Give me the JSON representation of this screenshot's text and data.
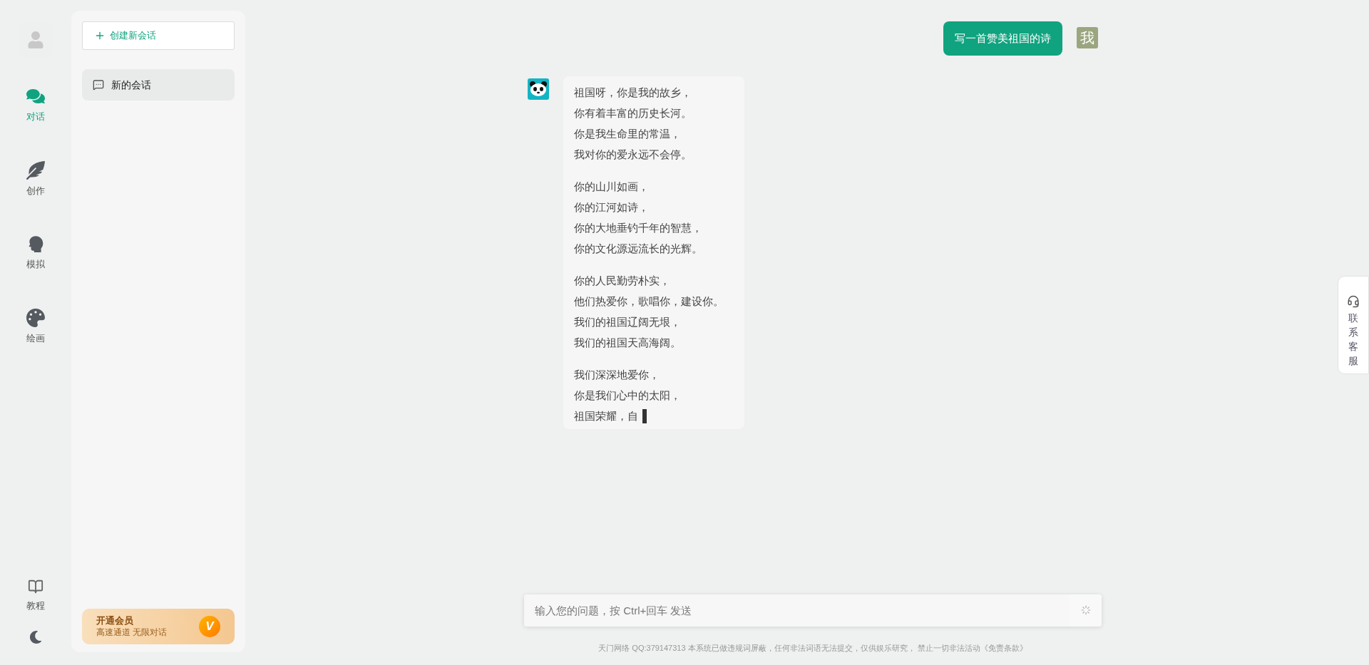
{
  "nav": [
    {
      "label": "对话",
      "kind": "chat",
      "selected": true
    },
    {
      "label": "创作",
      "kind": "write",
      "selected": false
    },
    {
      "label": "模拟",
      "kind": "role",
      "selected": false
    },
    {
      "label": "绘画",
      "kind": "paint",
      "selected": false
    }
  ],
  "nav_bottom": {
    "label": "教程"
  },
  "sidebar": {
    "new_button": "创建新会话",
    "conversations": [
      {
        "title": "新的会话",
        "selected": true
      }
    ],
    "membership": {
      "title": "开通会员",
      "subtitle": "高速通道 无限对话",
      "badge": "V"
    }
  },
  "messages": [
    {
      "kind": "user",
      "avatar": "我",
      "text": "写一首赞美祖国的诗"
    },
    {
      "kind": "assistant",
      "streaming": true,
      "stanzas": [
        [
          "祖国呀，你是我的故乡，",
          "你有着丰富的历史长河。",
          "你是我生命里的常温，",
          "我对你的爱永远不会停。"
        ],
        [
          "你的山川如画，",
          "你的江河如诗，",
          "你的大地垂钓千年的智慧，",
          "你的文化源远流长的光辉。"
        ],
        [
          "你的人民勤劳朴实，",
          "他们热爱你，歌唱你，建设你。",
          "我们的祖国辽阔无垠，",
          "我们的祖国天高海阔。"
        ],
        [
          "我们深深地爱你，",
          "你是我们心中的太阳，",
          "祖国荣耀，自"
        ]
      ]
    }
  ],
  "input": {
    "placeholder": "输入您的问题，按 Ctrl+回车 发送"
  },
  "footer": "天门网络 QQ:379147313 本系统已做违规词屏蔽，任何非法词语无法提交，仅供娱乐研究， 禁止一切非法活动《免责条款》",
  "support_tab": "联系客服"
}
